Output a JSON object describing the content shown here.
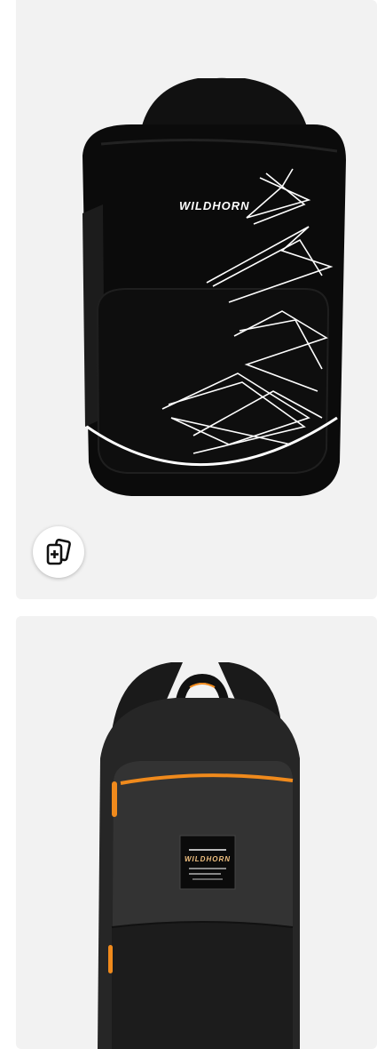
{
  "products": [
    {
      "brand_text": "WILDHORN",
      "bag_color": "#0b0b0b",
      "accent_color": "#ffffff",
      "compare_icon": "add-to-compare-icon"
    },
    {
      "brand_text": "WILDHORN",
      "bag_color": "#2b2b2b",
      "accent_color": "#f08a1c"
    }
  ],
  "colors": {
    "card_background": "#f2f2f2",
    "page_background": "#ffffff"
  }
}
